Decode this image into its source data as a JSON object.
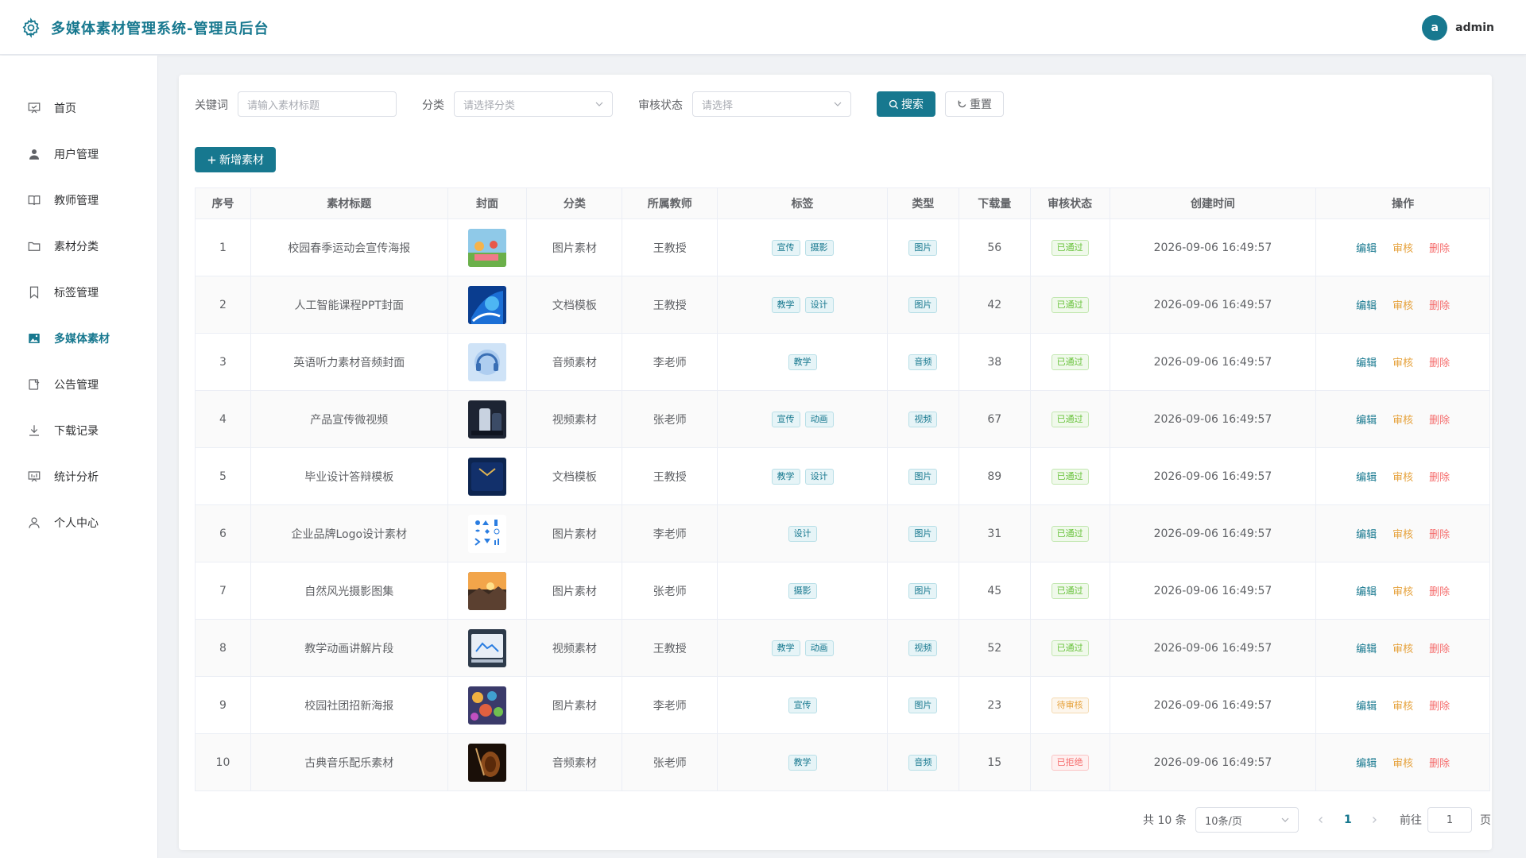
{
  "header": {
    "title": "多媒体素材管理系统-管理员后台",
    "avatar_letter": "a",
    "username": "admin"
  },
  "sidebar": {
    "items": [
      {
        "label": "首页",
        "icon": "presentation-icon"
      },
      {
        "label": "用户管理",
        "icon": "user-icon"
      },
      {
        "label": "教师管理",
        "icon": "book-icon"
      },
      {
        "label": "素材分类",
        "icon": "folder-icon"
      },
      {
        "label": "标签管理",
        "icon": "bookmark-icon"
      },
      {
        "label": "多媒体素材",
        "icon": "picture-icon",
        "active": true
      },
      {
        "label": "公告管理",
        "icon": "notice-icon"
      },
      {
        "label": "下载记录",
        "icon": "download-icon"
      },
      {
        "label": "统计分析",
        "icon": "chart-icon"
      },
      {
        "label": "个人中心",
        "icon": "person-icon"
      }
    ]
  },
  "filters": {
    "keyword_label": "关键词",
    "keyword_placeholder": "请输入素材标题",
    "category_label": "分类",
    "category_placeholder": "请选择分类",
    "status_label": "审核状态",
    "status_placeholder": "请选择",
    "search_label": "搜索",
    "reset_label": "重置"
  },
  "add_button": "新增素材",
  "table": {
    "headers": [
      "序号",
      "素材标题",
      "封面",
      "分类",
      "所属教师",
      "标签",
      "类型",
      "下载量",
      "审核状态",
      "创建时间",
      "操作"
    ],
    "rows": [
      {
        "no": "1",
        "title": "校园春季运动会宣传海报",
        "category": "图片素材",
        "teacher": "王教授",
        "tags": [
          "宣传",
          "摄影"
        ],
        "type": "图片",
        "downloads": "56",
        "status": "已通过",
        "status_kind": "approved",
        "created": "2026-09-06 16:49:57"
      },
      {
        "no": "2",
        "title": "人工智能课程PPT封面",
        "category": "文档模板",
        "teacher": "王教授",
        "tags": [
          "教学",
          "设计"
        ],
        "type": "图片",
        "downloads": "42",
        "status": "已通过",
        "status_kind": "approved",
        "created": "2026-09-06 16:49:57"
      },
      {
        "no": "3",
        "title": "英语听力素材音频封面",
        "category": "音频素材",
        "teacher": "李老师",
        "tags": [
          "教学"
        ],
        "type": "音频",
        "downloads": "38",
        "status": "已通过",
        "status_kind": "approved",
        "created": "2026-09-06 16:49:57"
      },
      {
        "no": "4",
        "title": "产品宣传微视频",
        "category": "视频素材",
        "teacher": "张老师",
        "tags": [
          "宣传",
          "动画"
        ],
        "type": "视频",
        "downloads": "67",
        "status": "已通过",
        "status_kind": "approved",
        "created": "2026-09-06 16:49:57"
      },
      {
        "no": "5",
        "title": "毕业设计答辩模板",
        "category": "文档模板",
        "teacher": "王教授",
        "tags": [
          "教学",
          "设计"
        ],
        "type": "图片",
        "downloads": "89",
        "status": "已通过",
        "status_kind": "approved",
        "created": "2026-09-06 16:49:57"
      },
      {
        "no": "6",
        "title": "企业品牌Logo设计素材",
        "category": "图片素材",
        "teacher": "李老师",
        "tags": [
          "设计"
        ],
        "type": "图片",
        "downloads": "31",
        "status": "已通过",
        "status_kind": "approved",
        "created": "2026-09-06 16:49:57"
      },
      {
        "no": "7",
        "title": "自然风光摄影图集",
        "category": "图片素材",
        "teacher": "张老师",
        "tags": [
          "摄影"
        ],
        "type": "图片",
        "downloads": "45",
        "status": "已通过",
        "status_kind": "approved",
        "created": "2026-09-06 16:49:57"
      },
      {
        "no": "8",
        "title": "教学动画讲解片段",
        "category": "视频素材",
        "teacher": "王教授",
        "tags": [
          "教学",
          "动画"
        ],
        "type": "视频",
        "downloads": "52",
        "status": "已通过",
        "status_kind": "approved",
        "created": "2026-09-06 16:49:57"
      },
      {
        "no": "9",
        "title": "校园社团招新海报",
        "category": "图片素材",
        "teacher": "李老师",
        "tags": [
          "宣传"
        ],
        "type": "图片",
        "downloads": "23",
        "status": "待审核",
        "status_kind": "pending",
        "created": "2026-09-06 16:49:57"
      },
      {
        "no": "10",
        "title": "古典音乐配乐素材",
        "category": "音频素材",
        "teacher": "张老师",
        "tags": [
          "教学"
        ],
        "type": "音频",
        "downloads": "15",
        "status": "已拒绝",
        "status_kind": "rejected",
        "created": "2026-09-06 16:49:57"
      }
    ],
    "actions": {
      "edit": "编辑",
      "audit": "审核",
      "delete": "删除"
    }
  },
  "pagination": {
    "total": "共 10 条",
    "page_size": "10条/页",
    "current_page": "1",
    "goto_label": "前往",
    "goto_value": "1",
    "page_suffix": "页"
  },
  "colors": {
    "primary": "#17788f",
    "approved": "#67c23a",
    "pending": "#e6a23c",
    "rejected": "#f56c6c"
  }
}
